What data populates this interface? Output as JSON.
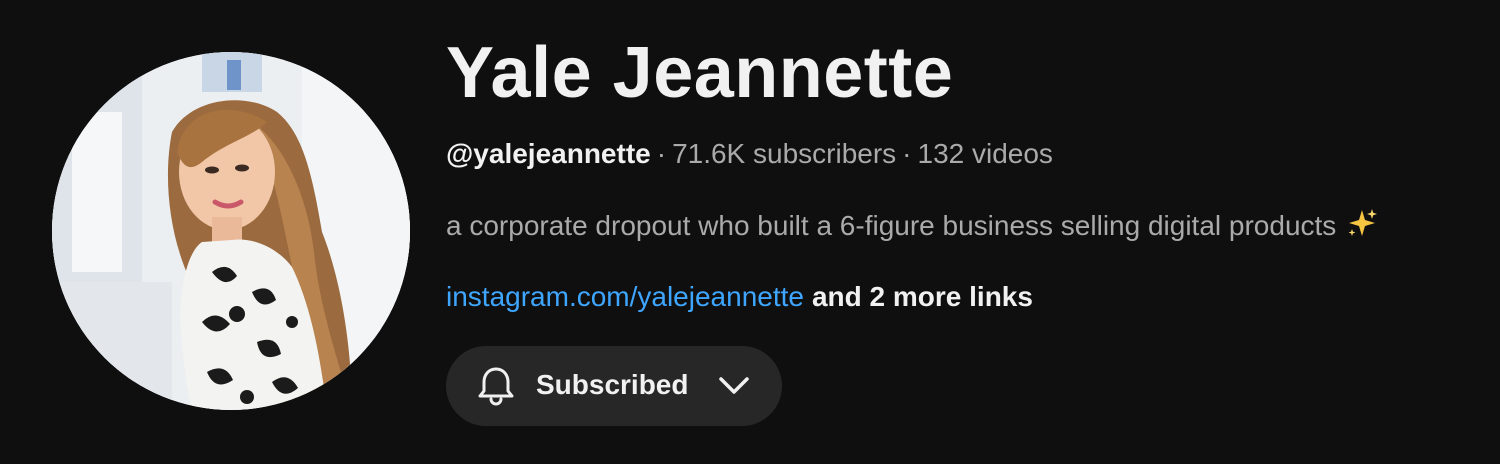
{
  "channel": {
    "name": "Yale Jeannette",
    "handle": "@yalejeannette",
    "separator": "·",
    "subscribers": "71.6K subscribers",
    "videos": "132 videos",
    "description": "a corporate dropout who built a 6-figure business selling digital products",
    "description_emoji_icon": "sparkles-icon",
    "primary_link": "instagram.com/yalejeannette",
    "more_links": "and 2 more links",
    "avatar_icon": "profile-photo"
  },
  "subscribe_button": {
    "label": "Subscribed",
    "icon_left": "bell-icon",
    "icon_right": "chevron-down-icon"
  },
  "colors": {
    "background": "#0f0f0f",
    "primary_text": "#f1f1f1",
    "secondary_text": "#aaaaaa",
    "link": "#3ea6ff",
    "button_bg": "#272727",
    "sparkle": "#f5c542"
  }
}
